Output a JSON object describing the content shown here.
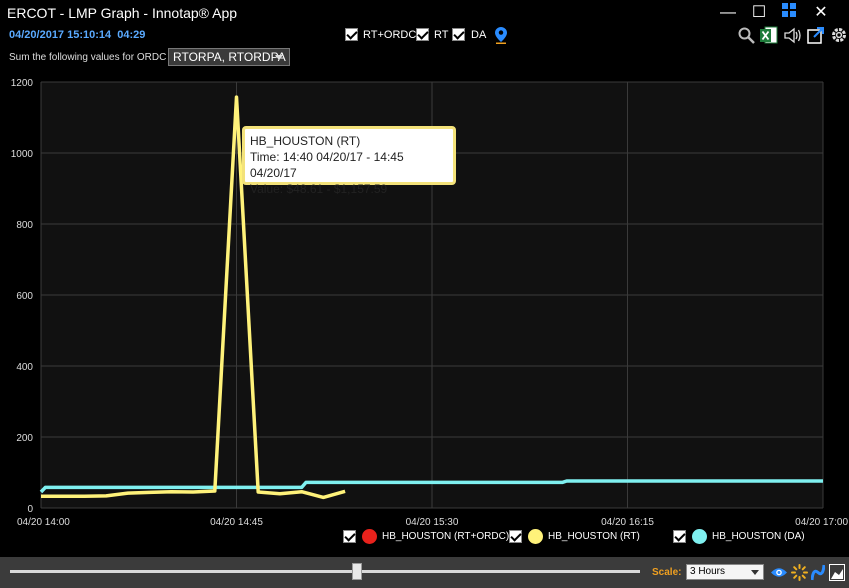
{
  "window": {
    "title": "ERCOT - LMP Graph - Innotap® App",
    "minimize_glyph": "—",
    "maximize_glyph": "☐",
    "close_glyph": "✕"
  },
  "toolbar": {
    "datetime": "04/20/2017 15:10:14",
    "interval": "04:29",
    "toggles": [
      {
        "label": "RT+ORDC",
        "checked": true
      },
      {
        "label": "RT",
        "checked": true
      },
      {
        "label": "DA",
        "checked": true
      }
    ],
    "icons": [
      "location-pin-icon",
      "search-icon",
      "excel-export-icon",
      "speaker-icon",
      "share-icon",
      "settings-gear-icon"
    ]
  },
  "ordc": {
    "label": "Sum the following values for ORDC",
    "selected": "RTORPA, RTORDPA"
  },
  "tooltip": {
    "title": "HB_HOUSTON (RT)",
    "time": "Time: 14:40 04/20/17 - 14:45 04/20/17",
    "value": "Value: $48.61 - $1,157.59"
  },
  "legend": [
    {
      "label": "HB_HOUSTON (RT+ORDC)",
      "color": "#e8221c",
      "checked": true
    },
    {
      "label": "HB_HOUSTON (RT)",
      "color": "#fff27a",
      "checked": true
    },
    {
      "label": "HB_HOUSTON (DA)",
      "color": "#7ff0f0",
      "checked": true
    }
  ],
  "bottom": {
    "scale_label": "Scale:",
    "scale_value": "3 Hours",
    "slider_value": 0.55
  },
  "chart_data": {
    "type": "line",
    "title": "",
    "xlabel": "",
    "ylabel": "",
    "x_ticks": [
      "04/20 14:00",
      "04/20 14:45",
      "04/20 15:30",
      "04/20 16:15",
      "04/20 17:00"
    ],
    "x_range_minutes": [
      0,
      180
    ],
    "ylim": [
      0,
      1200
    ],
    "y_ticks": [
      0,
      200,
      400,
      600,
      800,
      1000,
      1200
    ],
    "grid": true,
    "series": [
      {
        "name": "HB_HOUSTON (RT)",
        "color": "#fff27a",
        "points": [
          [
            0,
            33
          ],
          [
            5,
            33
          ],
          [
            10,
            33
          ],
          [
            15,
            34
          ],
          [
            20,
            42
          ],
          [
            25,
            44
          ],
          [
            30,
            46
          ],
          [
            35,
            45
          ],
          [
            40,
            48
          ],
          [
            45,
            1157.59
          ],
          [
            50,
            45
          ],
          [
            55,
            40
          ],
          [
            60,
            46
          ],
          [
            65,
            30
          ],
          [
            70,
            47
          ]
        ]
      },
      {
        "name": "HB_HOUSTON (DA)",
        "color": "#7ff0f0",
        "points": [
          [
            0,
            45
          ],
          [
            1,
            58
          ],
          [
            60,
            58
          ],
          [
            61,
            72
          ],
          [
            120,
            72
          ],
          [
            121,
            76
          ],
          [
            180,
            76
          ]
        ]
      }
    ]
  }
}
